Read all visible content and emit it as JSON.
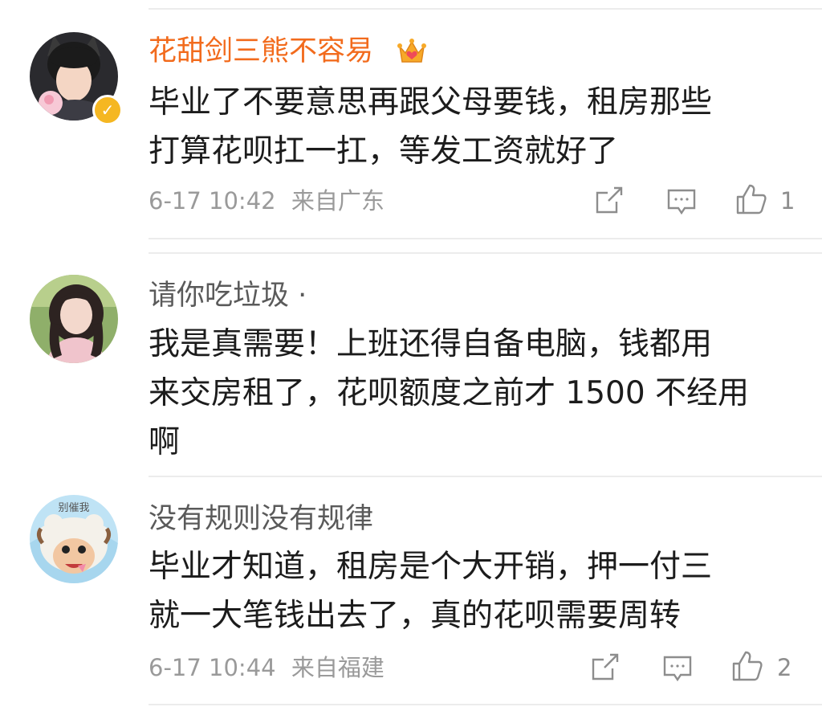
{
  "comments": [
    {
      "username": "花甜剑三熊不容易",
      "text_lines": [
        "毕业了不要意思再跟父母要钱，租房那些",
        "打算花呗扛一扛，等发工资就好了"
      ],
      "time": "6-17 10:42",
      "location": "来自广东",
      "likes": "1"
    },
    {
      "username": "请你吃垃圾 ·",
      "text_lines": [
        "我是真需要！上班还得自备电脑，钱都用",
        "来交房租了，花呗额度之前才 1500 不经用",
        "啊"
      ]
    },
    {
      "username": "没有规则没有规律",
      "avatar_text": "别催我",
      "text_lines": [
        "毕业才知道，租房是个大开销，押一付三",
        "就一大笔钱出去了，真的花呗需要周转"
      ],
      "time": "6-17 10:44",
      "location": "来自福建",
      "likes": "2"
    }
  ],
  "colors": {
    "vip_name": "#f26b1d",
    "username": "#5a5a5a",
    "meta": "#9a9a9a",
    "verified_badge": "#f5b722"
  },
  "icons": [
    "crown-icon",
    "verified-badge-icon",
    "share-icon",
    "comment-icon",
    "like-icon"
  ]
}
